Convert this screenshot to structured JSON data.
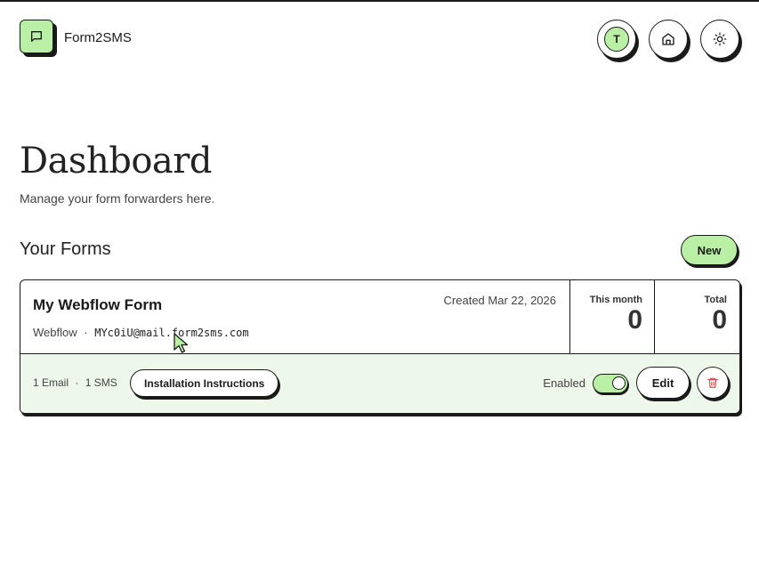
{
  "header": {
    "brand": "Form2SMS",
    "avatar_initial": "T"
  },
  "icons": {
    "logo": "message-square-icon",
    "home": "home-icon",
    "theme": "sun-icon",
    "delete": "trash-icon"
  },
  "colors": {
    "accent": "#b9f0a5",
    "card_footer": "#edf8ea",
    "delete": "#e04848",
    "ink": "#1a1a1a"
  },
  "page": {
    "title": "Dashboard",
    "subtitle": "Manage your form forwarders here."
  },
  "forms_section": {
    "title": "Your Forms",
    "new_label": "New"
  },
  "form": {
    "name": "My Webflow Form",
    "platform": "Webflow",
    "separator": "·",
    "email": "MYc0iU@mail.form2sms.com",
    "created": "Created Mar 22, 2026",
    "stats": {
      "month_label": "This month",
      "month_value": "0",
      "total_label": "Total",
      "total_value": "0"
    },
    "email_count": "1 Email",
    "sms_count": "1 SMS",
    "install_label": "Installation Instructions",
    "enabled_label": "Enabled",
    "enabled": true,
    "edit_label": "Edit"
  }
}
